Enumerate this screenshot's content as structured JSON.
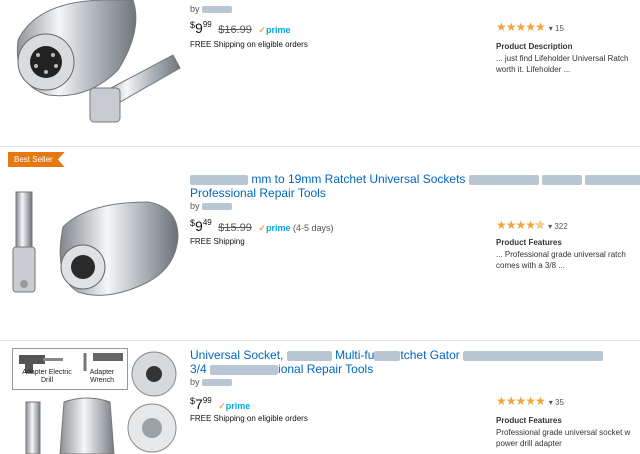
{
  "items": [
    {
      "price_dollar": "$",
      "price_whole": "9",
      "price_cents": "99",
      "was_price": "$16.99",
      "prime": "prime",
      "shipping": "FREE Shipping on eligible orders",
      "stars": "★★★★★",
      "rating_count": "15",
      "section_label": "Product Description",
      "desc_line1": "... just find Lifeholder Universal Ratch",
      "desc_line2": "worth it. Lifeholder ..."
    },
    {
      "badge": "Best Seller",
      "title_line1_visible": "mm to 19mm Ratchet Universal Sockets",
      "title_line2": "Professional Repair Tools",
      "price_dollar": "$",
      "price_whole": "9",
      "price_cents": "49",
      "was_price": "$15.99",
      "prime": "prime",
      "delivery": "(4-5 days)",
      "shipping": "FREE Shipping",
      "stars": "★★★★✯",
      "rating_count": "322",
      "section_label": "Product Features",
      "desc_line1": "... Professional grade universal ratch",
      "desc_line2": "comes with a 3/8 ..."
    },
    {
      "title_line1a": "Universal Socket,",
      "title_line1b": "Multi-fu",
      "title_line1c": "tchet Gator",
      "title_line2a": "3/4",
      "title_line2b": "ional Repair Tools",
      "image_labels": [
        "Adapter Electric Drill",
        "Adapter Wrench"
      ],
      "price_dollar": "$",
      "price_whole": "7",
      "price_cents": "99",
      "prime": "prime",
      "shipping": "FREE Shipping on eligible orders",
      "stars": "★★★★★",
      "rating_count": "35",
      "section_label": "Product Features",
      "desc_line1": "Professional grade universal socket w",
      "desc_line2": "power drill adapter"
    }
  ],
  "by_label": "by",
  "colors": {
    "link": "#0066c0",
    "star": "#f0a43b",
    "prime": "#00a8e1",
    "badge": "#e47911"
  },
  "icons": [
    "socket-product-image",
    "check-icon",
    "star-rating-icon",
    "chevron-down-icon"
  ]
}
